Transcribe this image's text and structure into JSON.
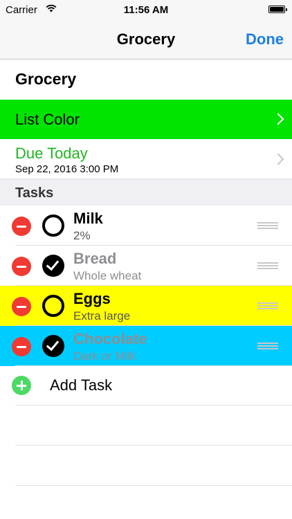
{
  "status_bar": {
    "carrier": "Carrier",
    "time": "11:56 AM"
  },
  "nav": {
    "title": "Grocery",
    "done_label": "Done"
  },
  "list": {
    "name": "Grocery",
    "color_label": "List Color",
    "color": "#00e400",
    "due_label": "Due Today",
    "due_date": "Sep 22, 2016 3:00 PM"
  },
  "tasks_header": "Tasks",
  "tasks": [
    {
      "name": "Milk",
      "note": "2%",
      "completed": false,
      "highlight": "#ffffff"
    },
    {
      "name": "Bread",
      "note": "Whole wheat",
      "completed": true,
      "highlight": "#ffffff"
    },
    {
      "name": "Eggs",
      "note": "Extra large",
      "completed": false,
      "highlight": "#ffff00"
    },
    {
      "name": "Chocolate",
      "note": "Dark or Milk",
      "completed": true,
      "highlight": "#00ccff"
    }
  ],
  "add_task_label": "Add Task",
  "colors": {
    "accent_blue": "#1b7fe3",
    "due_green": "#21b521",
    "delete_red": "#f03a33",
    "add_green": "#4cd964"
  }
}
